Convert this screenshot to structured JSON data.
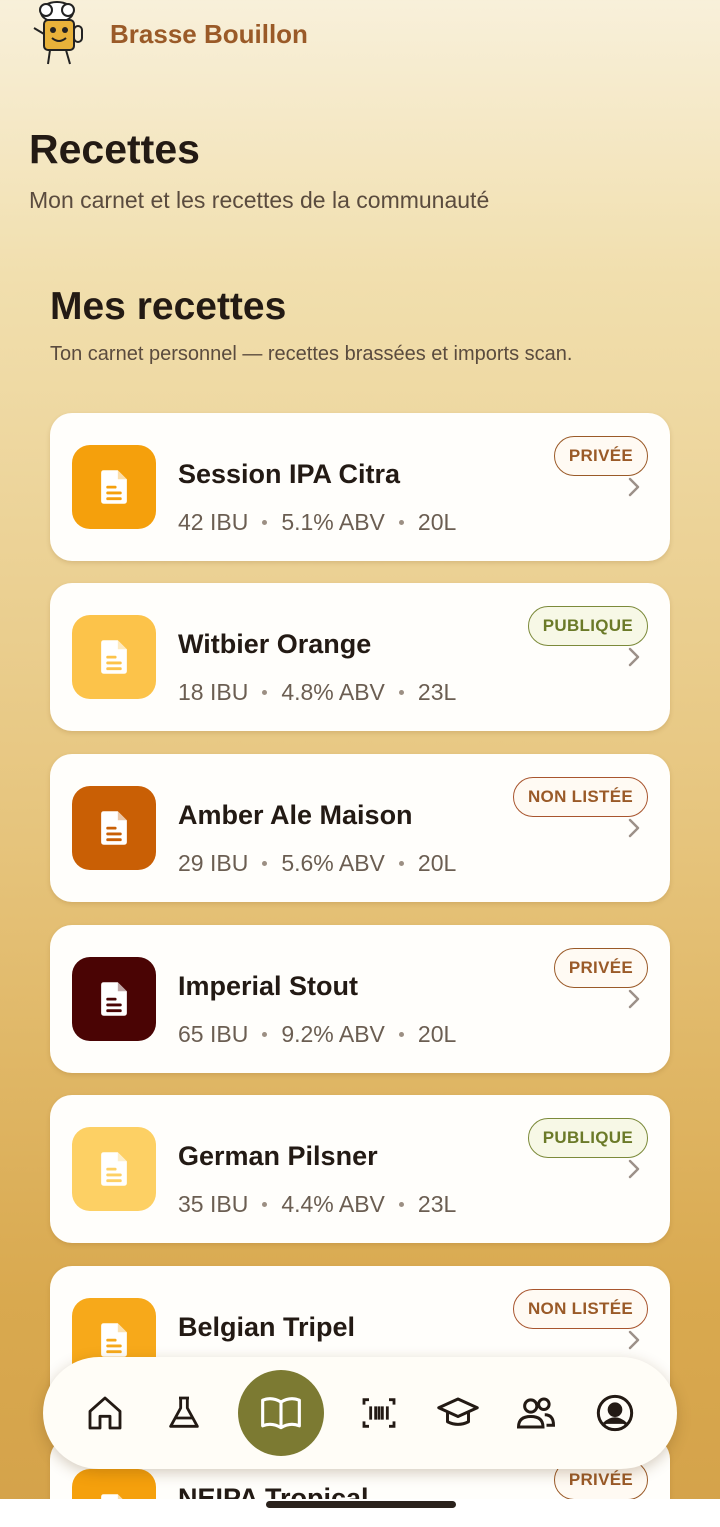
{
  "header": {
    "brand": "Brasse Bouillon"
  },
  "page": {
    "title": "Recettes",
    "subtitle": "Mon carnet et les recettes de la communauté"
  },
  "section": {
    "title": "Mes recettes",
    "subtitle": "Ton carnet personnel — recettes brassées et imports scan."
  },
  "recipes": [
    {
      "name": "Session IPA Citra",
      "ibu": "42 IBU",
      "abv": "5.1% ABV",
      "volume": "20L",
      "badge": "PRIVÉE",
      "badge_type": "privee",
      "color": "#f5a00c"
    },
    {
      "name": "Witbier Orange",
      "ibu": "18 IBU",
      "abv": "4.8% ABV",
      "volume": "23L",
      "badge": "PUBLIQUE",
      "badge_type": "publique",
      "color": "#fcc34a"
    },
    {
      "name": "Amber Ale Maison",
      "ibu": "29 IBU",
      "abv": "5.6% ABV",
      "volume": "20L",
      "badge": "NON LISTÉE",
      "badge_type": "nonlistee",
      "color": "#c95f05"
    },
    {
      "name": "Imperial Stout",
      "ibu": "65 IBU",
      "abv": "9.2% ABV",
      "volume": "20L",
      "badge": "PRIVÉE",
      "badge_type": "privee",
      "color": "#4a0404"
    },
    {
      "name": "German Pilsner",
      "ibu": "35 IBU",
      "abv": "4.4% ABV",
      "volume": "23L",
      "badge": "PUBLIQUE",
      "badge_type": "publique",
      "color": "#fdd064"
    },
    {
      "name": "Belgian Tripel",
      "ibu": "",
      "abv": "",
      "volume": "",
      "badge": "NON LISTÉE",
      "badge_type": "nonlistee",
      "color": "#f7a91a"
    },
    {
      "name": "NEIPA Tropical",
      "ibu": "",
      "abv": "",
      "volume": "",
      "badge": "PRIVÉE",
      "badge_type": "privee",
      "color": "#f5a00c"
    }
  ],
  "nav": [
    {
      "icon": "home-icon",
      "active": false
    },
    {
      "icon": "flask-icon",
      "active": false
    },
    {
      "icon": "book-icon",
      "active": true
    },
    {
      "icon": "barcode-scan-icon",
      "active": false
    },
    {
      "icon": "graduation-cap-icon",
      "active": false
    },
    {
      "icon": "community-icon",
      "active": false
    },
    {
      "icon": "profile-icon",
      "active": false
    }
  ]
}
